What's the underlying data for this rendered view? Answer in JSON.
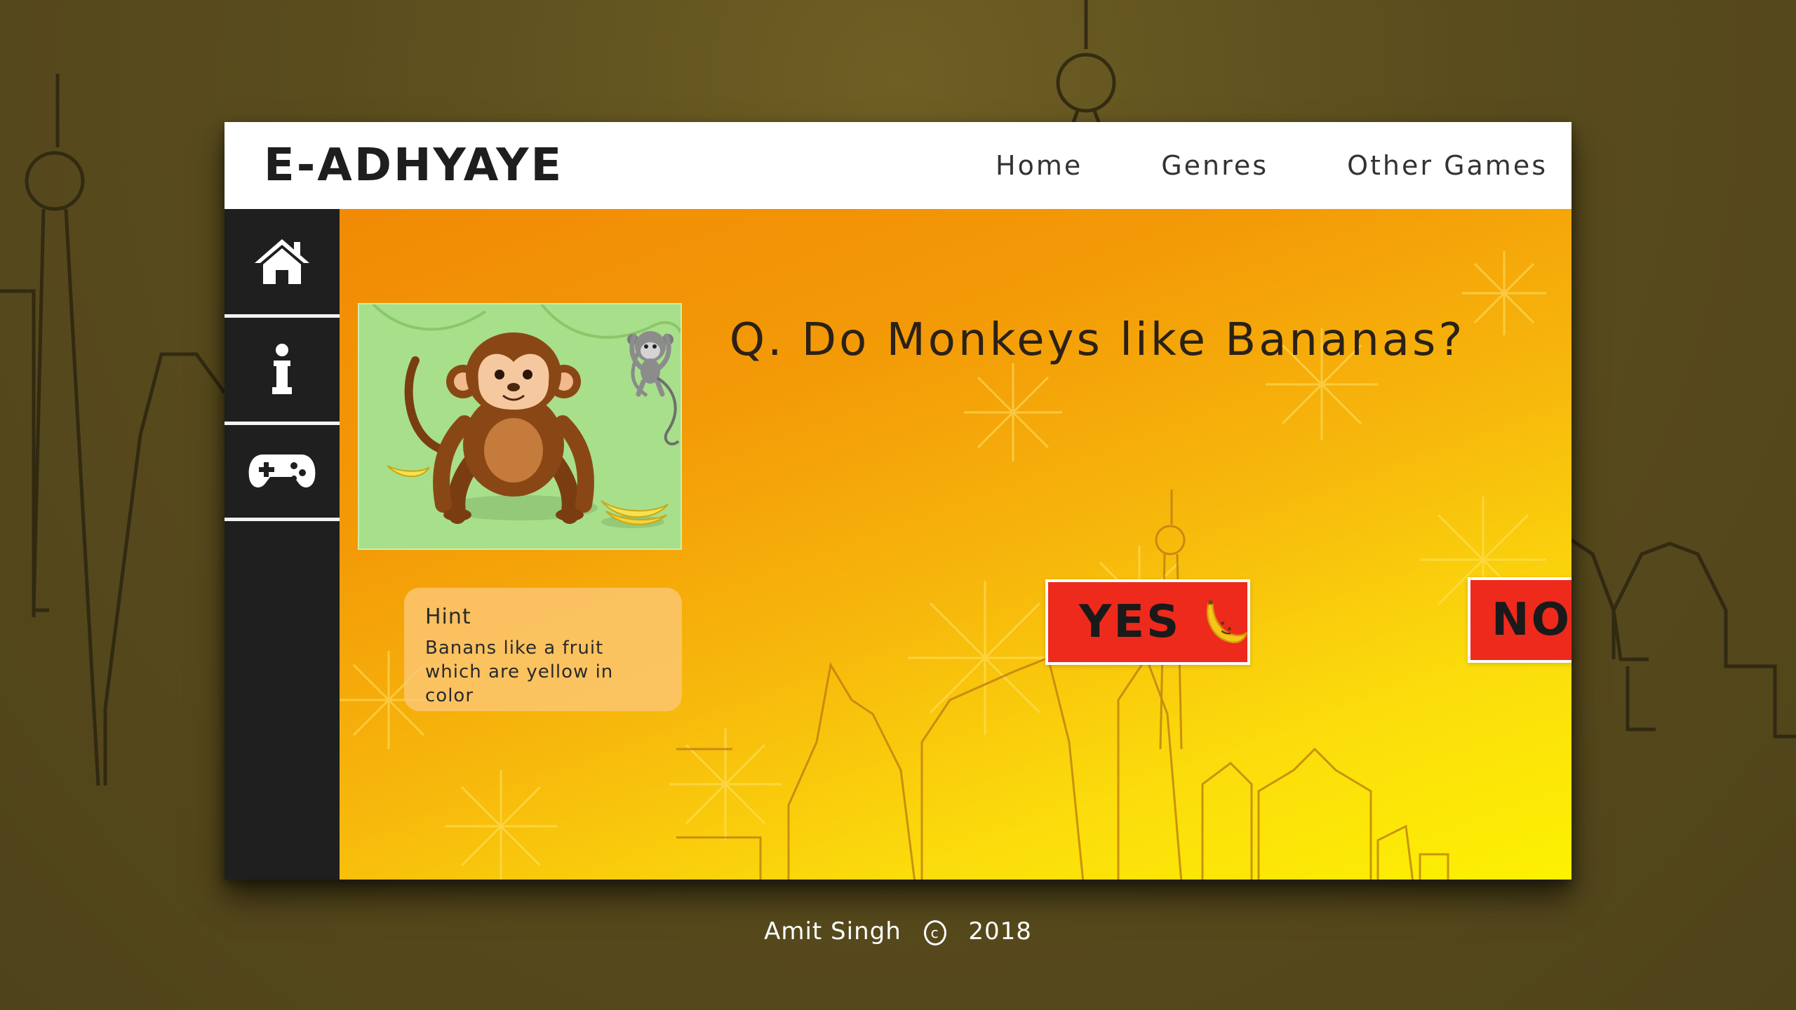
{
  "brand": "E-ADHYAYE",
  "nav": {
    "links": [
      "Home",
      "Genres",
      "Other Games"
    ]
  },
  "sidebar": {
    "items": [
      {
        "icon": "home-icon"
      },
      {
        "icon": "info-icon"
      },
      {
        "icon": "gamepad-icon"
      }
    ]
  },
  "quiz": {
    "question": "Q. Do Monkeys like Bananas?",
    "yes_label": "YES",
    "no_label": "NO"
  },
  "hint": {
    "title": "Hint",
    "line1": "Banans like a fruit",
    "line2": "which are yellow in color"
  },
  "footer": {
    "author": "Amit Singh",
    "copyright_symbol": "c",
    "year": "2018"
  },
  "colors": {
    "background": "#5a4c1d",
    "navbar": "#ffffff",
    "sidebar": "#1f1f1f",
    "content_gradient_start": "#f18a05",
    "content_gradient_end": "#fdf102",
    "answer_button": "#ee2a1d",
    "banana": "#f7c51a"
  }
}
